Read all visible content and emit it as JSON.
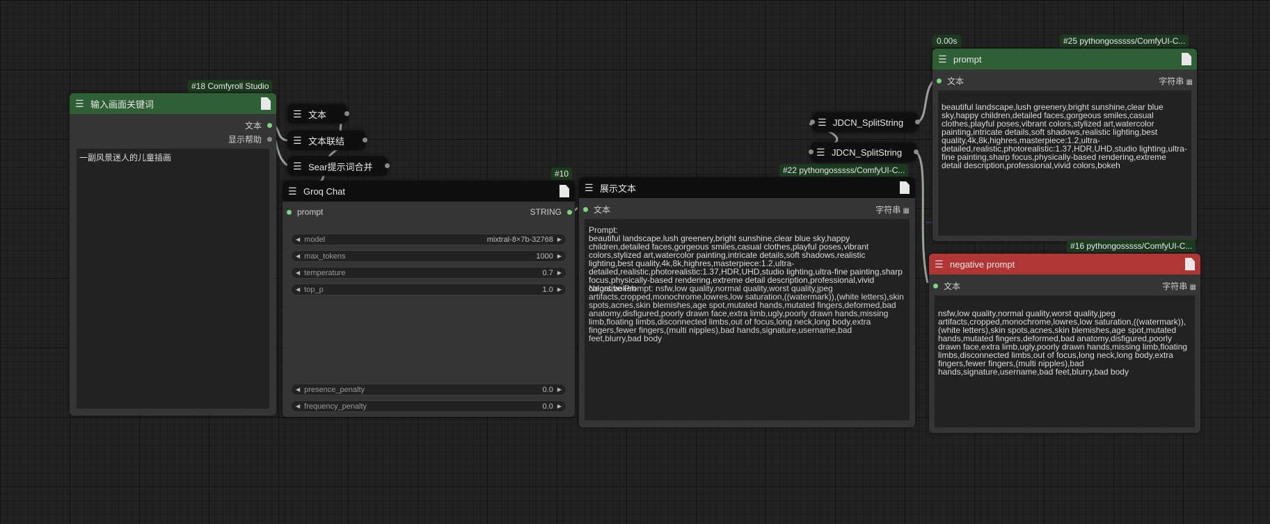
{
  "nodes": {
    "input": {
      "badge": "#18 Comfyroll Studio",
      "title": "输入画面关键词",
      "out1": "文本",
      "out2": "显示帮助",
      "text": "一副风景迷人的儿童插画"
    },
    "groq": {
      "badge": "#10",
      "title": "Groq Chat",
      "in_label": "prompt",
      "out_label": "STRING",
      "widgets": [
        {
          "name": "model",
          "value": "mixtral-8×7b-32768"
        },
        {
          "name": "max_tokens",
          "value": "1000"
        },
        {
          "name": "temperature",
          "value": "0.7"
        },
        {
          "name": "top_p",
          "value": "1.0"
        },
        {
          "name": "presence_penalty",
          "value": "0.0"
        },
        {
          "name": "frequency_penalty",
          "value": "0.0"
        }
      ]
    },
    "show": {
      "title": "展示文本",
      "in_label": "文本",
      "type_label": "字符串",
      "text_line1": "Prompt:",
      "text_body": "beautiful landscape,lush greenery,bright sunshine,clear blue sky,happy children,detailed faces,gorgeous smiles,casual clothes,playful poses,vibrant colors,stylized art,watercolor painting,intricate details,soft shadows,realistic lighting,best quality,4k,8k,highres,masterpiece:1.2,ultra-detailed,realistic,photorealistic:1.37,HDR,UHD,studio lighting,ultra-fine painting,sharp focus,physically-based rendering,extreme detail description,professional,vivid colors,bokeh",
      "text_body2": "Negative Prompt: nsfw,low quality,normal quality,worst quality,jpeg artifacts,cropped,monochrome,lowres,low saturation,((watermark)),(white letters),skin spots,acnes,skin blemishes,age spot,mutated hands,mutated fingers,deformed,bad anatomy,disfigured,poorly drawn face,extra limb,ugly,poorly drawn hands,missing limb,floating limbs,disconnected limbs,out of focus,long neck,long body,extra fingers,fewer fingers,(multi nipples),bad hands,signature,username,bad feet,blurry,bad body"
    },
    "text_node": {
      "title": "文本"
    },
    "concat": {
      "title": "文本联结"
    },
    "sear": {
      "title": "Sear提示词合并"
    },
    "split1": {
      "title": "JDCN_SplitString"
    },
    "split2": {
      "title": "JDCN_SplitString",
      "badge": "#22 pythongosssss/ComfyUI-C..."
    },
    "prompt": {
      "time": "0.00s",
      "badge": "#25 pythongosssss/ComfyUI-C...",
      "title": "prompt",
      "in_label": "文本",
      "type_label": "字符串",
      "text": "beautiful landscape,lush greenery,bright sunshine,clear blue sky,happy children,detailed faces,gorgeous smiles,casual clothes,playful poses,vibrant colors,stylized art,watercolor painting,intricate details,soft shadows,realistic lighting,best quality,4k,8k,highres,masterpiece:1.2,ultra-detailed,realistic,photorealistic:1.37,HDR,UHD,studio lighting,ultra-fine painting,sharp focus,physically-based rendering,extreme detail description,professional,vivid colors,bokeh"
    },
    "negative": {
      "badge": "#16 pythongosssss/ComfyUI-C...",
      "title": "negative prompt",
      "in_label": "文本",
      "type_label": "字符串",
      "text": "nsfw,low quality,normal quality,worst quality,jpeg artifacts,cropped,monochrome,lowres,low saturation,((watermark)),(white letters),skin spots,acnes,skin blemishes,age spot,mutated hands,mutated fingers,deformed,bad anatomy,disfigured,poorly drawn face,extra limb,ugly,poorly drawn hands,missing limb,floating limbs,disconnected limbs,out of focus,long neck,long body,extra fingers,fewer fingers,(multi nipples),bad hands,signature,username,bad feet,blurry,bad body"
    }
  },
  "icons": {
    "menu": "menu-icon",
    "doc": "document-icon",
    "arrow_left": "arrow-left-icon",
    "arrow_right": "arrow-right-icon",
    "grid": "grid-icon"
  },
  "colors": {
    "canvas": "#222222",
    "node_body": "#353535",
    "title_green": "#2f5f34",
    "title_dark": "#0f0f0f",
    "title_red": "#b23535",
    "slot_green": "#7ed67e"
  }
}
